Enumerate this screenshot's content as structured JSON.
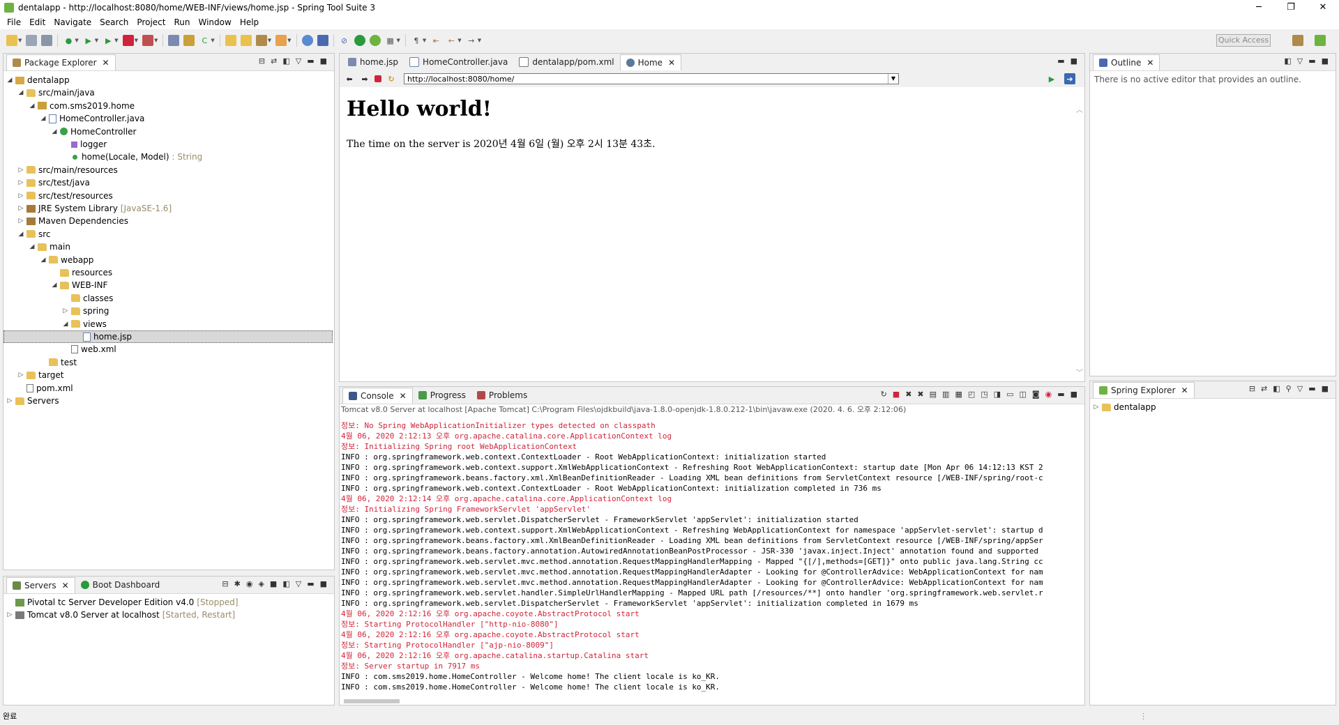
{
  "window": {
    "title": "dentalapp - http://localhost:8080/home/WEB-INF/views/home.jsp - Spring Tool Suite 3",
    "minimize": "─",
    "maximize": "❐",
    "close": "✕"
  },
  "menu": [
    "File",
    "Edit",
    "Navigate",
    "Search",
    "Project",
    "Run",
    "Window",
    "Help"
  ],
  "toolbar": {
    "quick_access_placeholder": "Quick Access"
  },
  "package_explorer": {
    "tab_label": "Package Explorer",
    "tree": [
      {
        "label": "dentalapp",
        "icon": "project-icon",
        "twisty": "◢",
        "hint": ""
      },
      {
        "label": "src/main/java",
        "icon": "package-folder-icon",
        "twisty": "◢",
        "hint": ""
      },
      {
        "label": "com.sms2019.home",
        "icon": "package-icon",
        "twisty": "◢",
        "hint": ""
      },
      {
        "label": "HomeController.java",
        "icon": "java-file-icon",
        "twisty": "◢",
        "hint": ""
      },
      {
        "label": "HomeController",
        "icon": "class-icon",
        "twisty": "◢",
        "hint": ""
      },
      {
        "label": "logger",
        "icon": "field-icon",
        "twisty": "",
        "hint": ""
      },
      {
        "label": "home(Locale, Model)",
        "icon": "method-icon",
        "twisty": "",
        "hint": ": String"
      },
      {
        "label": "src/main/resources",
        "icon": "package-folder-icon",
        "twisty": "▷",
        "hint": ""
      },
      {
        "label": "src/test/java",
        "icon": "package-folder-icon",
        "twisty": "▷",
        "hint": ""
      },
      {
        "label": "src/test/resources",
        "icon": "package-folder-icon",
        "twisty": "▷",
        "hint": ""
      },
      {
        "label": "JRE System Library",
        "icon": "library-icon",
        "twisty": "▷",
        "hint": "[JavaSE-1.6]"
      },
      {
        "label": "Maven Dependencies",
        "icon": "library-icon",
        "twisty": "▷",
        "hint": ""
      },
      {
        "label": "src",
        "icon": "folder-icon",
        "twisty": "◢",
        "hint": ""
      },
      {
        "label": "main",
        "icon": "folder-icon",
        "twisty": "◢",
        "hint": ""
      },
      {
        "label": "webapp",
        "icon": "folder-icon",
        "twisty": "◢",
        "hint": ""
      },
      {
        "label": "resources",
        "icon": "folder-icon",
        "twisty": "",
        "hint": ""
      },
      {
        "label": "WEB-INF",
        "icon": "folder-icon",
        "twisty": "◢",
        "hint": ""
      },
      {
        "label": "classes",
        "icon": "folder-icon",
        "twisty": "",
        "hint": ""
      },
      {
        "label": "spring",
        "icon": "folder-icon",
        "twisty": "▷",
        "hint": ""
      },
      {
        "label": "views",
        "icon": "folder-icon",
        "twisty": "◢",
        "hint": ""
      },
      {
        "label": "home.jsp",
        "icon": "jsp-file-icon",
        "twisty": "",
        "hint": "",
        "selected": true
      },
      {
        "label": "web.xml",
        "icon": "xml-file-icon",
        "twisty": "",
        "hint": ""
      },
      {
        "label": "test",
        "icon": "folder-icon",
        "twisty": "",
        "hint": ""
      },
      {
        "label": "target",
        "icon": "folder-icon",
        "twisty": "▷",
        "hint": ""
      },
      {
        "label": "pom.xml",
        "icon": "xml-file-icon",
        "twisty": "",
        "hint": ""
      },
      {
        "label": "Servers",
        "icon": "folder-icon",
        "twisty": "▷",
        "hint": ""
      }
    ]
  },
  "servers_panel": {
    "tabs": [
      "Servers",
      "Boot Dashboard"
    ],
    "items": [
      {
        "label": "Pivotal tc Server Developer Edition v4.0",
        "status": "[Stopped]",
        "twisty": ""
      },
      {
        "label": "Tomcat v8.0 Server at localhost",
        "status": "[Started, Restart]",
        "twisty": "▷"
      }
    ]
  },
  "editor": {
    "tabs": [
      "home.jsp",
      "HomeController.java",
      "dentalapp/pom.xml",
      "Home"
    ],
    "active_tab": "Home",
    "url": "http://localhost:8080/home/",
    "page_heading": "Hello world!",
    "page_text": "The time on the server is 2020년 4월 6일 (월) 오후 2시 13분 43초."
  },
  "console": {
    "tabs": [
      "Console",
      "Progress",
      "Problems"
    ],
    "header": "Tomcat v8.0 Server at localhost [Apache Tomcat] C:\\Program Files\\ojdkbuild\\java-1.8.0-openjdk-1.8.0.212-1\\bin\\javaw.exe (2020. 4. 6. 오후 2:12:06)",
    "lines": [
      {
        "t": "err",
        "text": "정보: No Spring WebApplicationInitializer types detected on classpath"
      },
      {
        "t": "err",
        "text": "4월 06, 2020 2:12:13 오후 org.apache.catalina.core.ApplicationContext log"
      },
      {
        "t": "err",
        "text": "정보: Initializing Spring root WebApplicationContext"
      },
      {
        "t": "info",
        "text": "INFO : org.springframework.web.context.ContextLoader - Root WebApplicationContext: initialization started"
      },
      {
        "t": "info",
        "text": "INFO : org.springframework.web.context.support.XmlWebApplicationContext - Refreshing Root WebApplicationContext: startup date [Mon Apr 06 14:12:13 KST 2"
      },
      {
        "t": "info",
        "text": "INFO : org.springframework.beans.factory.xml.XmlBeanDefinitionReader - Loading XML bean definitions from ServletContext resource [/WEB-INF/spring/root-c"
      },
      {
        "t": "info",
        "text": "INFO : org.springframework.web.context.ContextLoader - Root WebApplicationContext: initialization completed in 736 ms"
      },
      {
        "t": "err",
        "text": "4월 06, 2020 2:12:14 오후 org.apache.catalina.core.ApplicationContext log"
      },
      {
        "t": "err",
        "text": "정보: Initializing Spring FrameworkServlet 'appServlet'"
      },
      {
        "t": "info",
        "text": "INFO : org.springframework.web.servlet.DispatcherServlet - FrameworkServlet 'appServlet': initialization started"
      },
      {
        "t": "info",
        "text": "INFO : org.springframework.web.context.support.XmlWebApplicationContext - Refreshing WebApplicationContext for namespace 'appServlet-servlet': startup d"
      },
      {
        "t": "info",
        "text": "INFO : org.springframework.beans.factory.xml.XmlBeanDefinitionReader - Loading XML bean definitions from ServletContext resource [/WEB-INF/spring/appSer"
      },
      {
        "t": "info",
        "text": "INFO : org.springframework.beans.factory.annotation.AutowiredAnnotationBeanPostProcessor - JSR-330 'javax.inject.Inject' annotation found and supported"
      },
      {
        "t": "info",
        "text": "INFO : org.springframework.web.servlet.mvc.method.annotation.RequestMappingHandlerMapping - Mapped \"{[/],methods=[GET]}\" onto public java.lang.String cc"
      },
      {
        "t": "info",
        "text": "INFO : org.springframework.web.servlet.mvc.method.annotation.RequestMappingHandlerAdapter - Looking for @ControllerAdvice: WebApplicationContext for nam"
      },
      {
        "t": "info",
        "text": "INFO : org.springframework.web.servlet.mvc.method.annotation.RequestMappingHandlerAdapter - Looking for @ControllerAdvice: WebApplicationContext for nam"
      },
      {
        "t": "info",
        "text": "INFO : org.springframework.web.servlet.handler.SimpleUrlHandlerMapping - Mapped URL path [/resources/**] onto handler 'org.springframework.web.servlet.r"
      },
      {
        "t": "info",
        "text": "INFO : org.springframework.web.servlet.DispatcherServlet - FrameworkServlet 'appServlet': initialization completed in 1679 ms"
      },
      {
        "t": "err",
        "text": "4월 06, 2020 2:12:16 오후 org.apache.coyote.AbstractProtocol start"
      },
      {
        "t": "err",
        "text": "정보: Starting ProtocolHandler [\"http-nio-8080\"]"
      },
      {
        "t": "err",
        "text": "4월 06, 2020 2:12:16 오후 org.apache.coyote.AbstractProtocol start"
      },
      {
        "t": "err",
        "text": "정보: Starting ProtocolHandler [\"ajp-nio-8009\"]"
      },
      {
        "t": "err",
        "text": "4월 06, 2020 2:12:16 오후 org.apache.catalina.startup.Catalina start"
      },
      {
        "t": "err",
        "text": "정보: Server startup in 7917 ms"
      },
      {
        "t": "info",
        "text": "INFO : com.sms2019.home.HomeController - Welcome home! The client locale is ko_KR."
      },
      {
        "t": "info",
        "text": "INFO : com.sms2019.home.HomeController - Welcome home! The client locale is ko_KR."
      }
    ]
  },
  "outline": {
    "tab_label": "Outline",
    "message": "There is no active editor that provides an outline."
  },
  "spring_explorer": {
    "tab_label": "Spring Explorer",
    "items": [
      {
        "label": "dentalapp",
        "twisty": "▷"
      }
    ]
  },
  "status_bar": {
    "text": "완료"
  },
  "colors": {
    "error_text": "#d0243a",
    "hint_text": "#9a8c6a",
    "go_arrow": "#2a9a3a",
    "stop_red": "#d0243a"
  }
}
